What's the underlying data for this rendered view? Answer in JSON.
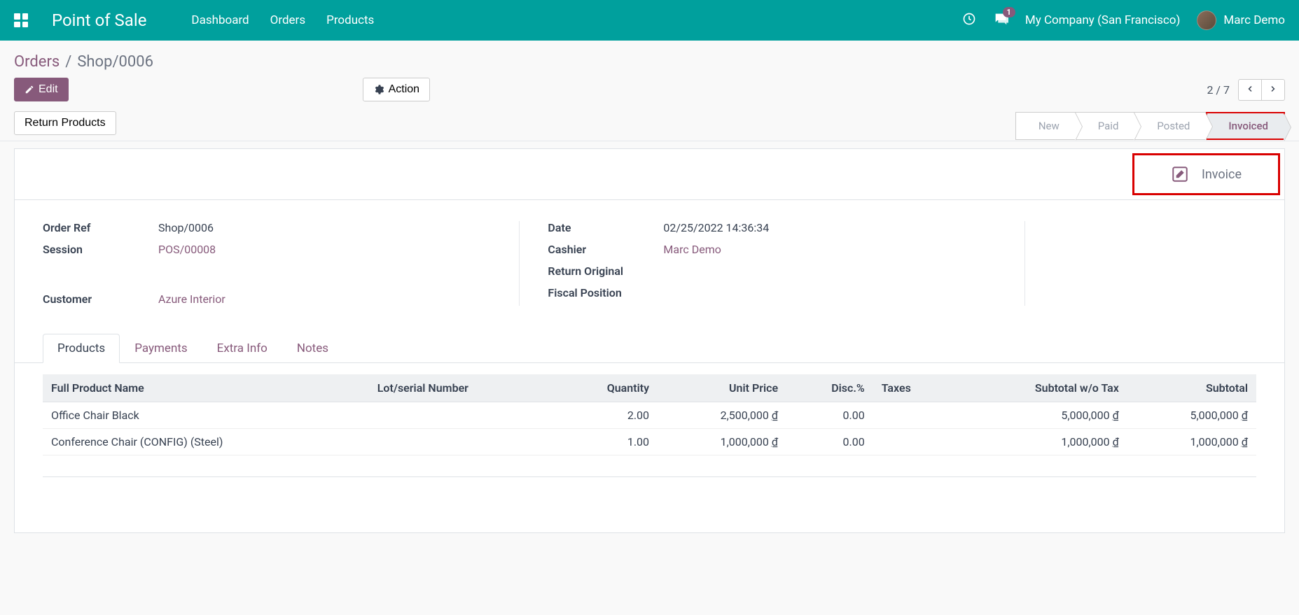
{
  "navbar": {
    "brand": "Point of Sale",
    "links": [
      "Dashboard",
      "Orders",
      "Products"
    ],
    "notification_count": "1",
    "company": "My Company (San Francisco)",
    "user": "Marc Demo"
  },
  "breadcrumb": {
    "parent": "Orders",
    "current": "Shop/0006"
  },
  "toolbar": {
    "edit_label": "Edit",
    "action_label": "Action",
    "pager": "2 / 7",
    "return_label": "Return Products"
  },
  "status": {
    "steps": [
      "New",
      "Paid",
      "Posted",
      "Invoiced"
    ],
    "active_index": 3
  },
  "stat_button": {
    "label": "Invoice"
  },
  "fields": {
    "order_ref": {
      "label": "Order Ref",
      "value": "Shop/0006"
    },
    "session": {
      "label": "Session",
      "value": "POS/00008"
    },
    "customer": {
      "label": "Customer",
      "value": "Azure Interior"
    },
    "date": {
      "label": "Date",
      "value": "02/25/2022 14:36:34"
    },
    "cashier": {
      "label": "Cashier",
      "value": "Marc Demo"
    },
    "return_original": {
      "label": "Return Original",
      "value": ""
    },
    "fiscal_position": {
      "label": "Fiscal Position",
      "value": ""
    }
  },
  "tabs": [
    "Products",
    "Payments",
    "Extra Info",
    "Notes"
  ],
  "table": {
    "headers": {
      "product": "Full Product Name",
      "lot": "Lot/serial Number",
      "qty": "Quantity",
      "price": "Unit Price",
      "disc": "Disc.%",
      "taxes": "Taxes",
      "subtotal_no_tax": "Subtotal w/o Tax",
      "subtotal": "Subtotal"
    },
    "rows": [
      {
        "product": "Office Chair Black",
        "lot": "",
        "qty": "2.00",
        "price": "2,500,000",
        "cur": "₫",
        "disc": "0.00",
        "taxes": "",
        "subtotal_no_tax": "5,000,000",
        "subtotal": "5,000,000"
      },
      {
        "product": "Conference Chair (CONFIG) (Steel)",
        "lot": "",
        "qty": "1.00",
        "price": "1,000,000",
        "cur": "₫",
        "disc": "0.00",
        "taxes": "",
        "subtotal_no_tax": "1,000,000",
        "subtotal": "1,000,000"
      }
    ]
  }
}
